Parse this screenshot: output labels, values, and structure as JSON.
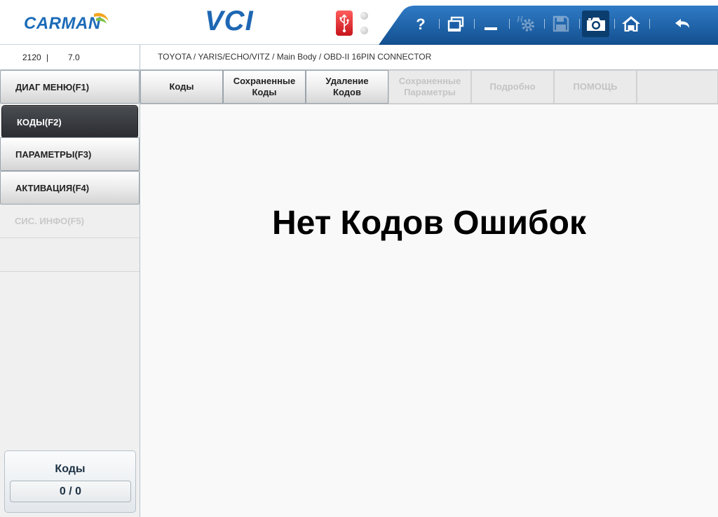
{
  "header": {
    "logo_text": "CARMAN",
    "product_title": "VCI",
    "toolbar": [
      {
        "name": "help-button",
        "icon": "question-icon",
        "state": "enabled"
      },
      {
        "name": "window-button",
        "icon": "window-restore-icon",
        "state": "enabled"
      },
      {
        "name": "minimize-button",
        "icon": "minimize-icon",
        "state": "enabled"
      },
      {
        "name": "settings-button",
        "icon": "gear-icon",
        "state": "disabled"
      },
      {
        "name": "save-button",
        "icon": "floppy-disk-icon",
        "state": "disabled"
      },
      {
        "name": "screenshot-button",
        "icon": "camera-icon",
        "state": "active"
      },
      {
        "name": "home-button",
        "icon": "home-icon",
        "state": "enabled"
      },
      {
        "name": "back-button",
        "icon": "back-arrow-icon",
        "state": "enabled"
      }
    ],
    "colors": {
      "brand_blue": "#1e67b4",
      "toolbar_blue": "#1c5ea6",
      "usb_red": "#d8232a"
    }
  },
  "infobar": {
    "version": "2120",
    "separator": "|",
    "software": "7.0",
    "breadcrumb": "TOYOTA / YARIS/ECHO/VITZ / Main Body / OBD-II 16PIN CONNECTOR"
  },
  "left_menu": {
    "items": [
      {
        "label": "ДИАГ МЕНЮ(F1)",
        "state": "normal"
      },
      {
        "label": "КОДЫ(F2)",
        "state": "selected"
      },
      {
        "label": "ПАРАМЕТРЫ(F3)",
        "state": "normal"
      },
      {
        "label": "АКТИВАЦИЯ(F4)",
        "state": "normal"
      },
      {
        "label": "СИС. ИНФО(F5)",
        "state": "disabled"
      }
    ],
    "codes_panel": {
      "title": "Коды",
      "count": "0 / 0"
    }
  },
  "tabs": [
    {
      "label": "Коды",
      "state": "normal"
    },
    {
      "label": "Сохраненные\nКоды",
      "state": "normal"
    },
    {
      "label": "Удаление\nКодов",
      "state": "normal"
    },
    {
      "label": "Сохраненные\nПараметры",
      "state": "disabled"
    },
    {
      "label": "Подробно",
      "state": "disabled"
    },
    {
      "label": "ПОМОЩЬ",
      "state": "disabled"
    }
  ],
  "content": {
    "message": "Нет Кодов Ошибок"
  }
}
